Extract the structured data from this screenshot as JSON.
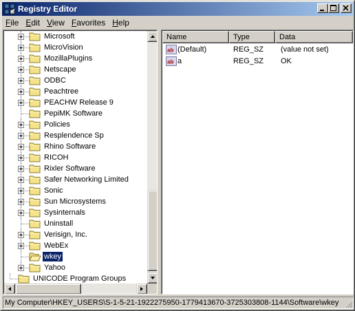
{
  "window": {
    "title": "Registry Editor"
  },
  "menu": [
    {
      "label": "File",
      "key": "F",
      "rest": "ile"
    },
    {
      "label": "Edit",
      "key": "E",
      "rest": "dit"
    },
    {
      "label": "View",
      "key": "V",
      "rest": "iew"
    },
    {
      "label": "Favorites",
      "key": "F",
      "rest": "avorites",
      "pre": "Fa"
    },
    {
      "label": "Help",
      "key": "H",
      "rest": "elp"
    }
  ],
  "tree": {
    "items": [
      {
        "label": "Microsoft",
        "expandable": true
      },
      {
        "label": "MicroVision",
        "expandable": true
      },
      {
        "label": "MozillaPlugins",
        "expandable": true
      },
      {
        "label": "Netscape",
        "expandable": true
      },
      {
        "label": "ODBC",
        "expandable": true
      },
      {
        "label": "Peachtree",
        "expandable": true
      },
      {
        "label": "PEACHW Release 9",
        "expandable": true
      },
      {
        "label": "PepiMK Software",
        "expandable": false
      },
      {
        "label": "Policies",
        "expandable": true
      },
      {
        "label": "Resplendence Sp",
        "expandable": true
      },
      {
        "label": "Rhino Software",
        "expandable": true
      },
      {
        "label": "RICOH",
        "expandable": true
      },
      {
        "label": "Rixler Software",
        "expandable": true
      },
      {
        "label": "Safer Networking Limited",
        "expandable": true
      },
      {
        "label": "Sonic",
        "expandable": true
      },
      {
        "label": "Sun Microsystems",
        "expandable": true
      },
      {
        "label": "Sysinternals",
        "expandable": true
      },
      {
        "label": "Uninstall",
        "expandable": false
      },
      {
        "label": "Verisign, Inc.",
        "expandable": true
      },
      {
        "label": "WebEx",
        "expandable": true
      },
      {
        "label": "wkey",
        "expandable": false,
        "selected": true
      },
      {
        "label": "Yahoo",
        "expandable": true
      },
      {
        "label": "UNICODE Program Groups",
        "expandable": false,
        "level": 0
      }
    ]
  },
  "list": {
    "columns": [
      "Name",
      "Type",
      "Data"
    ],
    "rows": [
      {
        "name": "(Default)",
        "type": "REG_SZ",
        "data": "(value not set)",
        "icon": "string-value-icon"
      },
      {
        "name": "a",
        "type": "REG_SZ",
        "data": "OK",
        "icon": "string-value-icon"
      }
    ]
  },
  "statusbar": {
    "path": "My Computer\\HKEY_USERS\\S-1-5-21-1922275950-1779413670-3725303808-1144\\Software\\wkey"
  }
}
